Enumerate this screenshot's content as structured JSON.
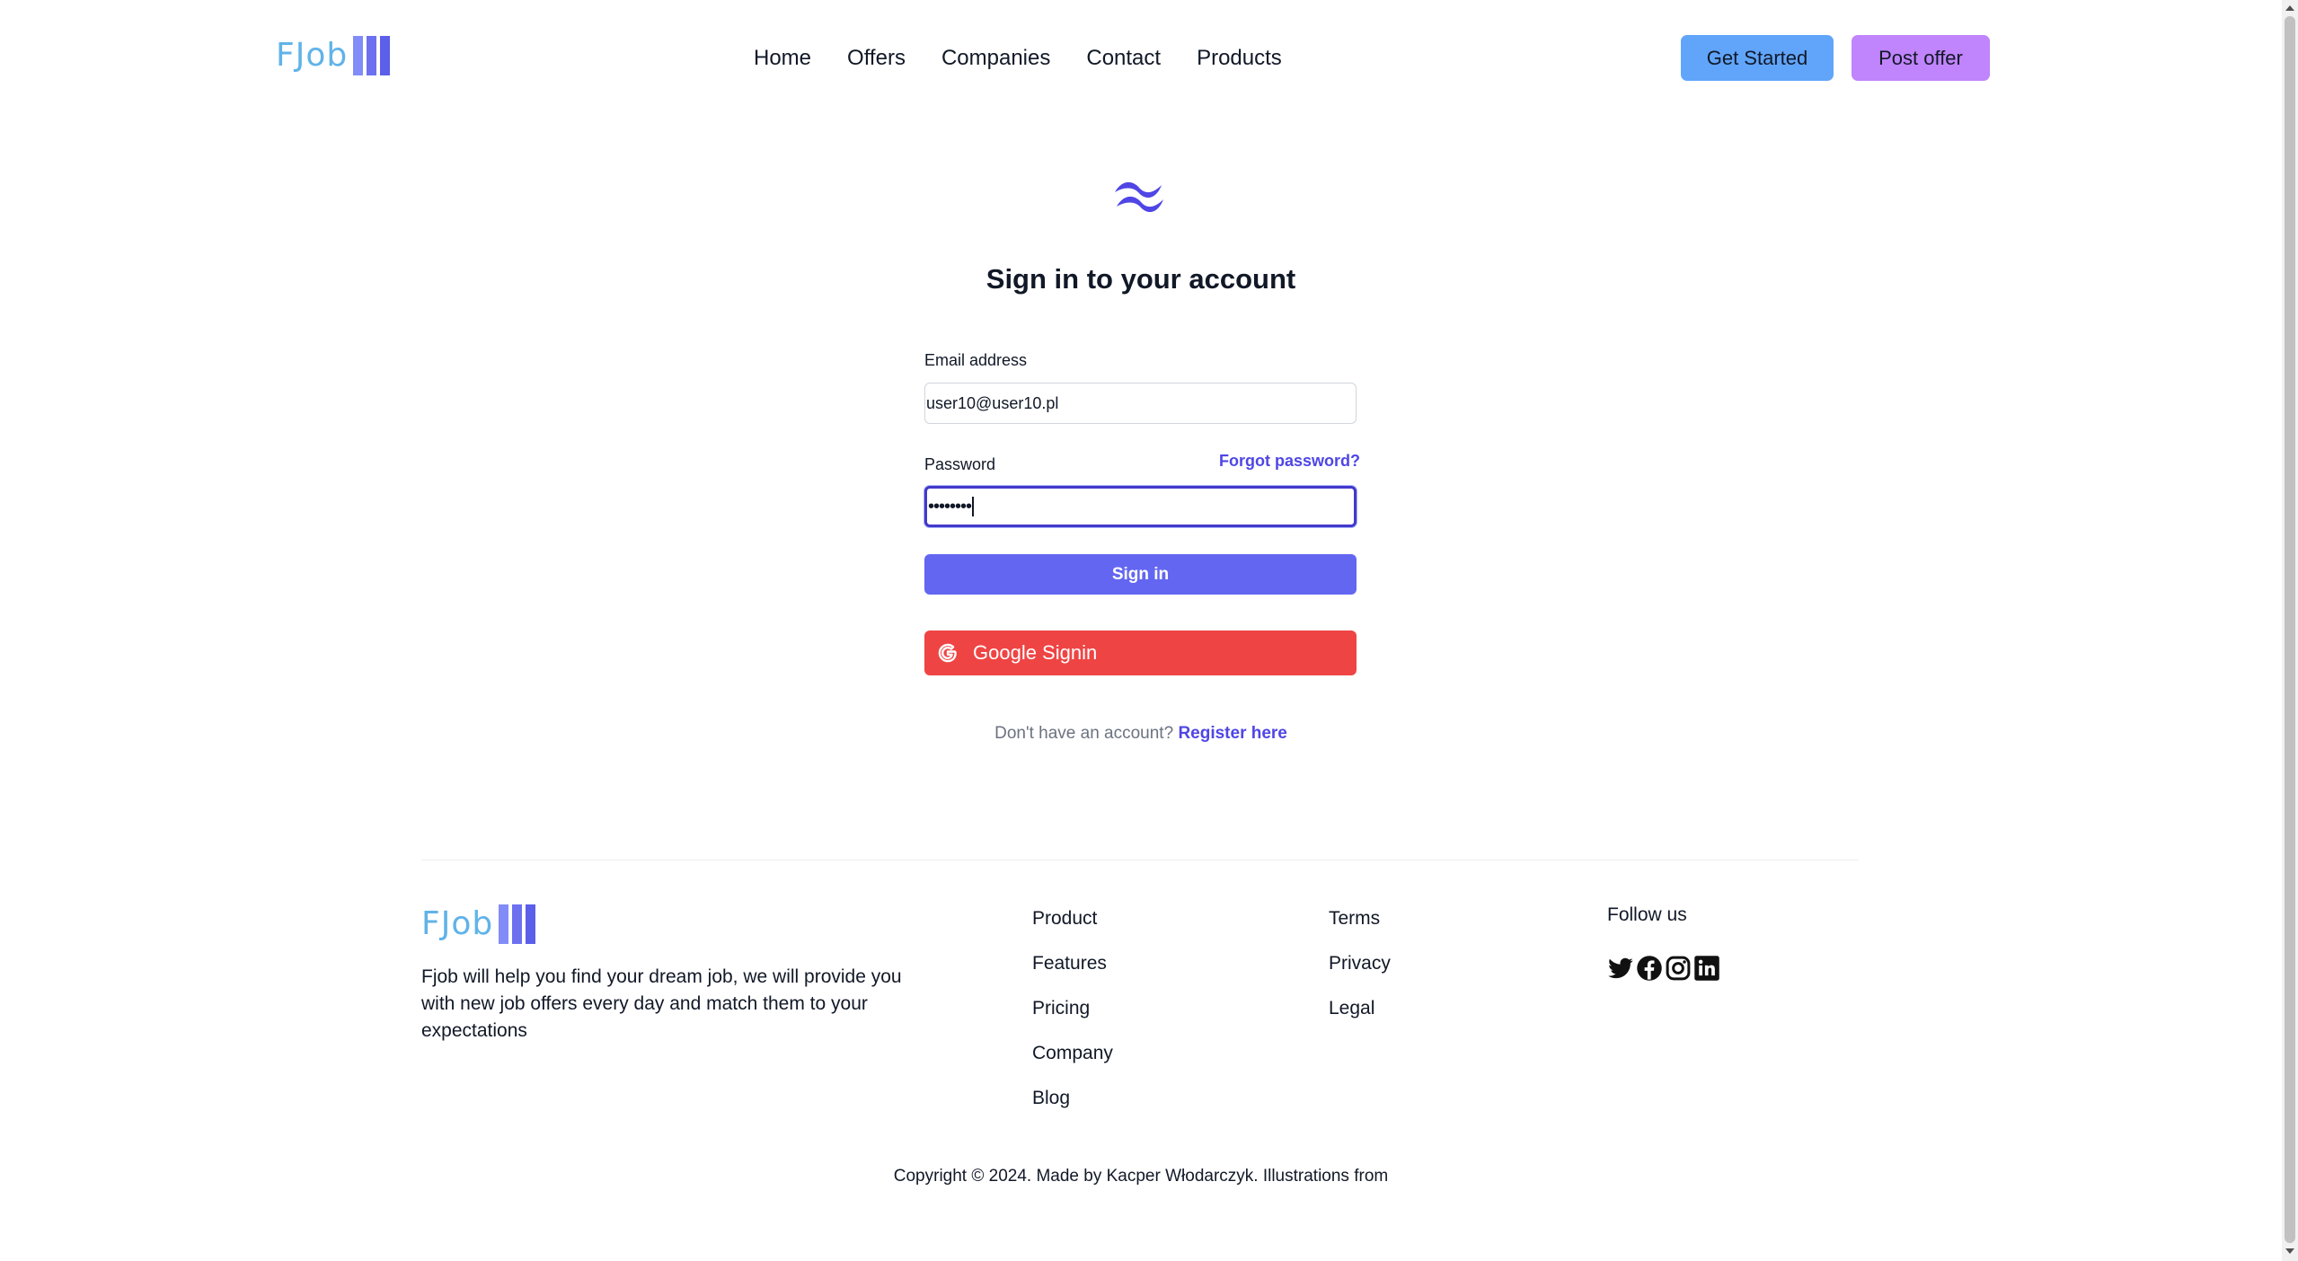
{
  "header": {
    "logo_text": "FJob",
    "nav": [
      "Home",
      "Offers",
      "Companies",
      "Contact",
      "Products"
    ],
    "get_started": "Get Started",
    "post_offer": "Post offer"
  },
  "signin": {
    "title": "Sign in to your account",
    "email_label": "Email address",
    "email_value": "user10@user10.pl",
    "password_label": "Password",
    "password_mask": "••••••••",
    "forgot": "Forgot password?",
    "signin_button": "Sign in",
    "google_button": "Google Signin",
    "no_account": "Don't have an account?",
    "register": "Register here"
  },
  "footer": {
    "logo_text": "FJob",
    "description": "Fjob will help you find your dream job, we will provide you with new job offers every day and match them to your expectations",
    "col1": [
      "Product",
      "Features",
      "Pricing",
      "Company",
      "Blog"
    ],
    "col2": [
      "Terms",
      "Privacy",
      "Legal"
    ],
    "follow": "Follow us",
    "socials": [
      "twitter-icon",
      "facebook-icon",
      "instagram-icon",
      "linkedin-icon"
    ],
    "copyright": "Copyright © 2024. Made by Kacper Włodarczyk. Illustrations from"
  },
  "colors": {
    "primary": "#6366f1",
    "google": "#ef4444",
    "get_started": "#60a5fa",
    "post_offer": "#c084fc",
    "link": "#4f46e5"
  }
}
